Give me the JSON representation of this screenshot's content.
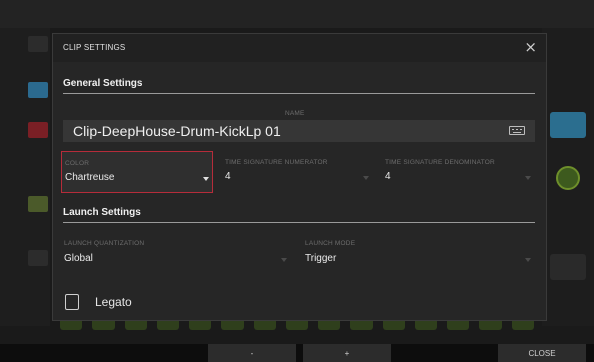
{
  "dialog": {
    "title": "CLIP SETTINGS",
    "close_glyph": "×"
  },
  "general": {
    "heading": "General Settings",
    "name_label": "NAME",
    "name_value": "Clip-DeepHouse-Drum-KickLp 01"
  },
  "color": {
    "label": "COLOR",
    "value": "Chartreuse",
    "accent": "#b62c3a"
  },
  "time_sig_numerator": {
    "label": "TIME SIGNATURE NUMERATOR",
    "value": "4"
  },
  "time_sig_denominator": {
    "label": "TIME SIGNATURE DENOMINATOR",
    "value": "4"
  },
  "launch": {
    "heading": "Launch Settings",
    "quantization_label": "LAUNCH QUANTIZATION",
    "quantization_value": "Global",
    "mode_label": "LAUNCH MODE",
    "mode_value": "Trigger"
  },
  "legato": {
    "label": "Legato",
    "checked": false
  },
  "footer": {
    "minus_label": "-",
    "plus_label": "+",
    "close_label": "CLOSE"
  }
}
